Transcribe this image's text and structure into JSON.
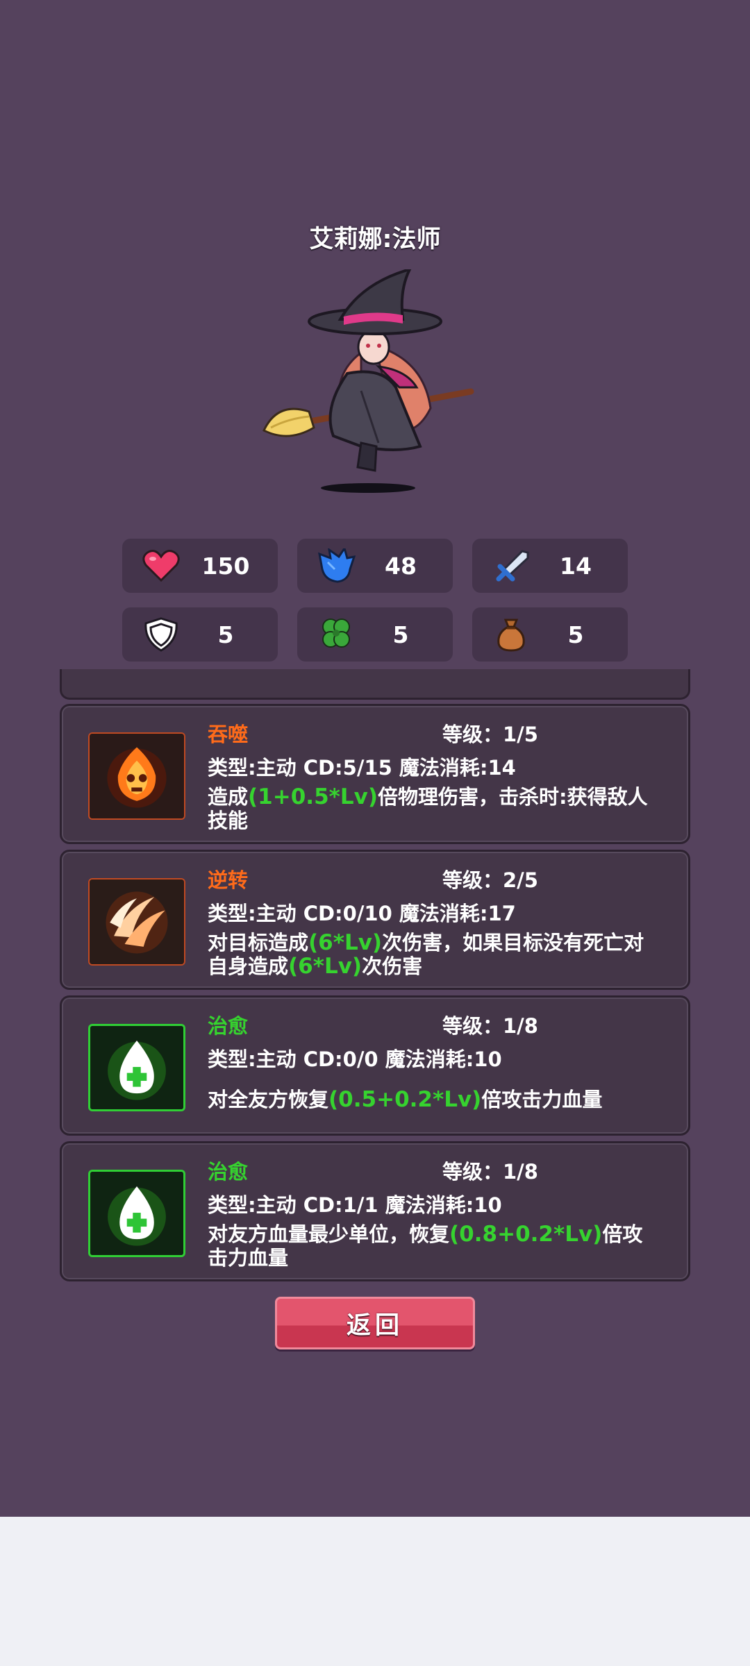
{
  "hero": {
    "title": "艾莉娜:法师"
  },
  "stats": [
    {
      "icon": "heart-icon",
      "value": "150"
    },
    {
      "icon": "mana-crystal-icon",
      "value": "48"
    },
    {
      "icon": "sword-icon",
      "value": "14"
    },
    {
      "icon": "shield-icon",
      "value": "5"
    },
    {
      "icon": "clover-icon",
      "value": "5"
    },
    {
      "icon": "money-bag-icon",
      "value": "5"
    }
  ],
  "skills": [
    {
      "icon": "fire-skull-icon",
      "name": "吞噬",
      "level": "等级：1/5",
      "meta": "类型:主动  CD:5/15  魔法消耗:14",
      "desc_pre": "造成",
      "desc_hl": "(1+0.5*Lv)",
      "desc_post": "倍物理伤害，击杀时:获得敌人技能"
    },
    {
      "icon": "slash-claw-icon",
      "name": "逆转",
      "level": "等级：2/5",
      "meta": "类型:主动  CD:0/10  魔法消耗:17",
      "desc_pre": "对目标造成",
      "desc_hl": "(6*Lv)",
      "desc_mid": "次伤害，如果目标没有死亡对自身造成",
      "desc_hl2": "(6*Lv)",
      "desc_post": "次伤害"
    },
    {
      "icon": "heal-drop-icon",
      "name": "治愈",
      "level": "等级：1/8",
      "meta": "类型:主动  CD:0/0  魔法消耗:10",
      "desc_pre": "对全友方恢复",
      "desc_hl": "(0.5+0.2*Lv)",
      "desc_post": "倍攻击力血量"
    },
    {
      "icon": "heal-drop-icon",
      "name": "治愈",
      "level": "等级：1/8",
      "meta": "类型:主动  CD:1/1  魔法消耗:10",
      "desc_pre": "对友方血量最少单位，恢复",
      "desc_hl": "(0.8+0.2*Lv)",
      "desc_post": "倍攻击力血量"
    }
  ],
  "back_label": "返回",
  "colors": {
    "background": "#55425d",
    "card": "#443648",
    "orange_name": "#ff6b1a",
    "green_name": "#36d32f",
    "button": "#e3556d"
  }
}
